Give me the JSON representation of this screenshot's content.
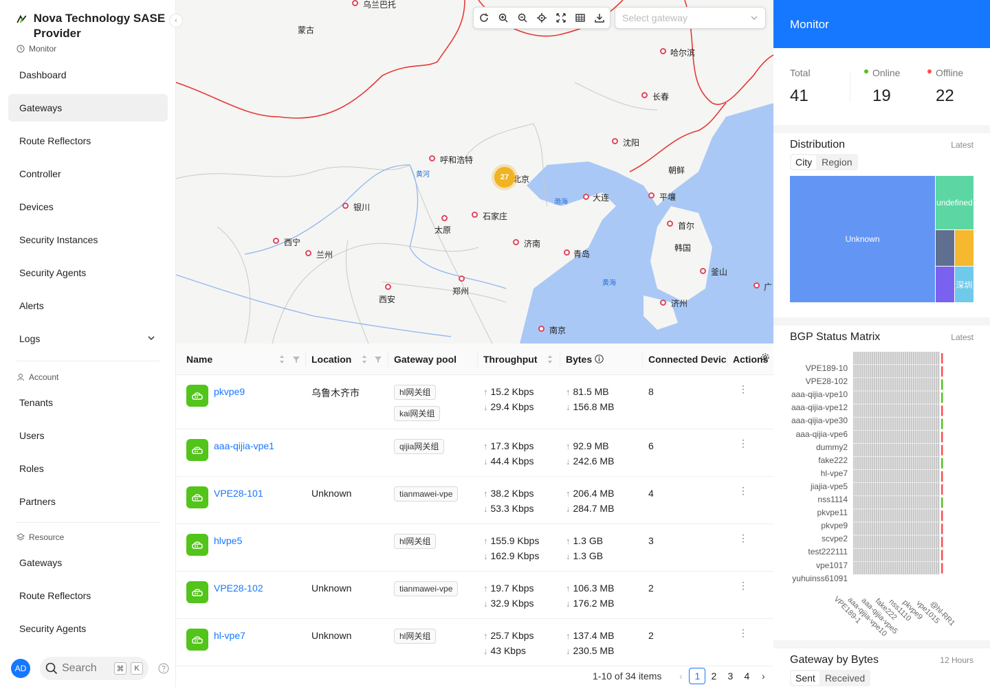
{
  "sidebar": {
    "brand": "Nova Technology SASE Provider",
    "groups": {
      "monitor": "Monitor",
      "account": "Account",
      "resource": "Resource"
    },
    "monitor_items": [
      "Dashboard",
      "Gateways",
      "Route Reflectors",
      "Controller",
      "Devices",
      "Security Instances",
      "Security Agents",
      "Alerts",
      "Logs"
    ],
    "account_items": [
      "Tenants",
      "Users",
      "Roles",
      "Partners"
    ],
    "resource_items": [
      "Gateways",
      "Route Reflectors",
      "Security Agents"
    ],
    "avatar": "AD",
    "search_placeholder": "Search",
    "kbd1": "⌘",
    "kbd2": "K"
  },
  "map": {
    "select_placeholder": "Select gateway",
    "cluster_count": "27",
    "cities": [
      "乌兰巴托",
      "哈尔滨",
      "长春",
      "沈阳",
      "呼和浩特",
      "北京",
      "朝鲜",
      "平壤",
      "大连",
      "银川",
      "石家庄",
      "首尔",
      "韩国",
      "西宁",
      "太原",
      "济南",
      "兰州",
      "青岛",
      "釜山",
      "郑州",
      "西安",
      "济州",
      "南京",
      "广"
    ],
    "regions": [
      "蒙古"
    ],
    "water": [
      "黄河",
      "渤海",
      "黄海"
    ]
  },
  "table": {
    "headers": {
      "name": "Name",
      "location": "Location",
      "pool": "Gateway pool",
      "throughput": "Throughput",
      "bytes": "Bytes",
      "connected": "Connected Devic",
      "actions": "Actions"
    },
    "rows": [
      {
        "name": "pkvpe9",
        "location": "乌鲁木齐市",
        "tags": [
          "hl网关组",
          "kai网关组"
        ],
        "tp_up": "15.2 Kbps",
        "tp_down": "29.4 Kbps",
        "b_up": "81.5 MB",
        "b_down": "156.8 MB",
        "connected": "8"
      },
      {
        "name": "aaa-qijia-vpe1",
        "location": "",
        "tags": [
          "qijia网关组"
        ],
        "tp_up": "17.3 Kbps",
        "tp_down": "44.4 Kbps",
        "b_up": "92.9 MB",
        "b_down": "242.6 MB",
        "connected": "6"
      },
      {
        "name": "VPE28-101",
        "location": "Unknown",
        "tags": [
          "tianmawei-vpe"
        ],
        "tp_up": "38.2 Kbps",
        "tp_down": "53.3 Kbps",
        "b_up": "206.4 MB",
        "b_down": "284.7 MB",
        "connected": "4"
      },
      {
        "name": "hlvpe5",
        "location": "",
        "tags": [
          "hl网关组"
        ],
        "tp_up": "155.9 Kbps",
        "tp_down": "162.9 Kbps",
        "b_up": "1.3 GB",
        "b_down": "1.3 GB",
        "connected": "3"
      },
      {
        "name": "VPE28-102",
        "location": "Unknown",
        "tags": [
          "tianmawei-vpe"
        ],
        "tp_up": "19.7 Kbps",
        "tp_down": "32.9 Kbps",
        "b_up": "106.3 MB",
        "b_down": "176.2 MB",
        "connected": "2"
      },
      {
        "name": "hl-vpe7",
        "location": "Unknown",
        "tags": [
          "hl网关组"
        ],
        "tp_up": "25.7 Kbps",
        "tp_down": "43 Kbps",
        "b_up": "137.4 MB",
        "b_down": "230.5 MB",
        "connected": "2"
      }
    ],
    "pagination": {
      "summary": "1-10 of 34 items",
      "pages": [
        "1",
        "2",
        "3",
        "4"
      ],
      "current": "1"
    }
  },
  "panel": {
    "title": "Monitor",
    "total_label": "Total",
    "total": "41",
    "online_label": "Online",
    "online": "19",
    "offline_label": "Offline",
    "offline": "22",
    "distribution": {
      "title": "Distribution",
      "sub": "Latest",
      "tabs": [
        "City",
        "Region"
      ],
      "active_tab": "City",
      "cells": [
        "Unknown",
        "undefined",
        "深圳"
      ]
    },
    "bgp": {
      "title": "BGP Status Matrix",
      "sub": "Latest",
      "rows": [
        "VPE189-10",
        "VPE28-102",
        "aaa-qijia-vpe10",
        "aaa-qijia-vpe12",
        "aaa-qijia-vpe30",
        "aaa-qijia-vpe6",
        "dummy2",
        "fake222",
        "hl-vpe7",
        "jiajia-vpe5",
        "nss1114",
        "pkvpe11",
        "pkvpe9",
        "scvpe2",
        "test222111",
        "vpe1017",
        "yuhuinss61091"
      ],
      "cols": [
        "VPE189-1",
        "aaa-qijia-vpe10",
        "aaa-qijia-vpe5",
        "fake222",
        "nss1110",
        "pkvpe9",
        "vpe1015",
        "@hl-RR1"
      ]
    },
    "bytes": {
      "title": "Gateway by Bytes",
      "sub": "12 Hours",
      "tabs": [
        "Sent",
        "Received"
      ],
      "active_tab": "Sent"
    }
  },
  "colors": {
    "primary": "#1677ff",
    "online": "#52c41a",
    "offline": "#ff4d4f",
    "gateway_icon": "#52c41a"
  }
}
